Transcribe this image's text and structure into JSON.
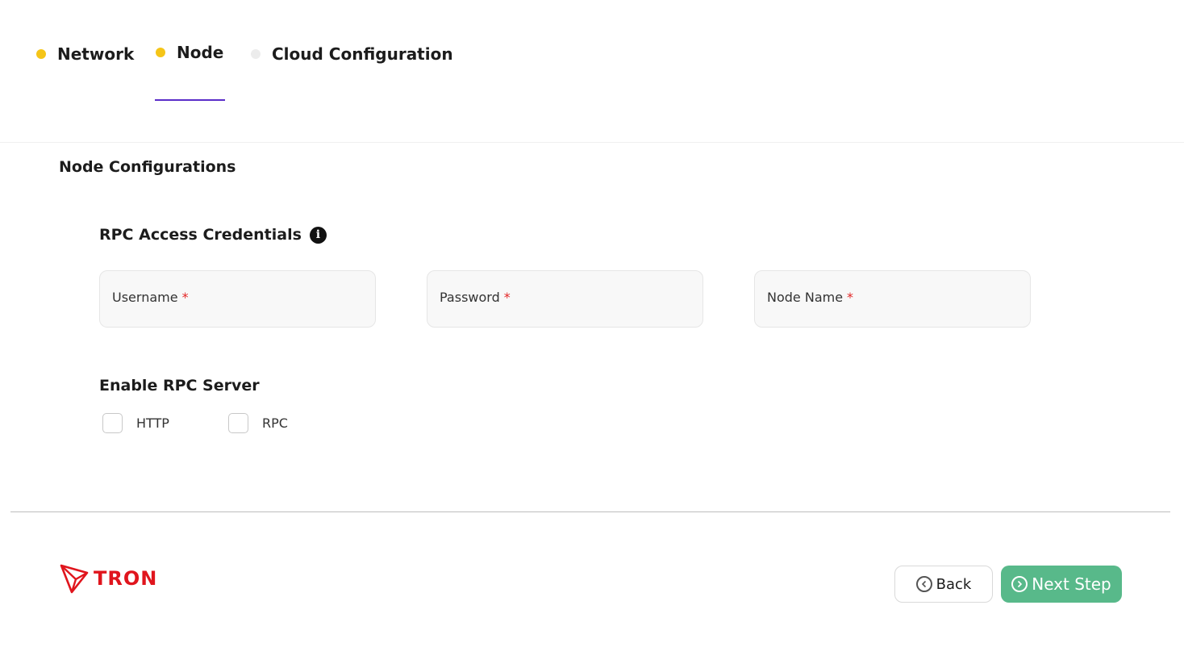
{
  "stepper": {
    "steps": [
      {
        "label": "Network",
        "dot_color": "#f5c518"
      },
      {
        "label": "Node",
        "dot_color": "#f5c518"
      },
      {
        "label": "Cloud Configuration",
        "dot_color": "#ececec"
      }
    ],
    "active_indicator_color": "#5b2ec9"
  },
  "main": {
    "section_title": "Node Configurations",
    "credentials": {
      "title": "RPC Access Credentials",
      "info_icon": "info-icon",
      "fields": [
        {
          "label": "Username",
          "required_mark": "*",
          "value": ""
        },
        {
          "label": "Password",
          "required_mark": "*",
          "value": ""
        },
        {
          "label": "Node Name",
          "required_mark": "*",
          "value": ""
        }
      ]
    },
    "rpc_server": {
      "title": "Enable RPC Server",
      "options": [
        {
          "label": "HTTP",
          "checked": false
        },
        {
          "label": "RPC",
          "checked": false
        }
      ]
    }
  },
  "footer": {
    "logo_text": "TRON",
    "logo_color": "#e0151d",
    "back_label": "Back",
    "next_label": "Next Step",
    "next_color": "#58b98a"
  }
}
